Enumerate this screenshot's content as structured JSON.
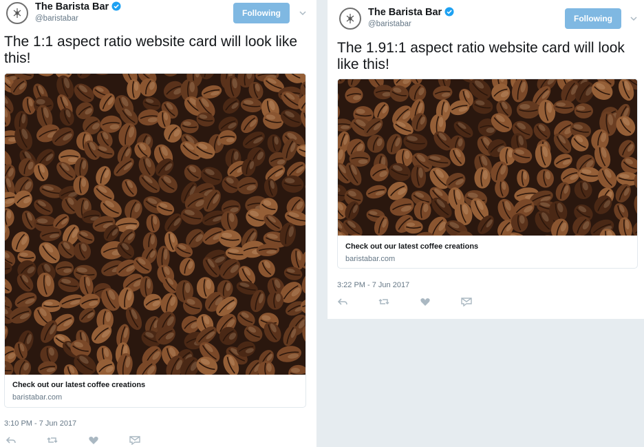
{
  "colors": {
    "accent": "#1da1f2",
    "following_bg": "#7fb8e2",
    "muted": "#657786",
    "bean_dark": "#3a2418"
  },
  "left": {
    "name": "The Barista Bar",
    "handle": "@baristabar",
    "follow_label": "Following",
    "text": "The 1:1 aspect ratio website card will look like this!",
    "card_title": "Check out our latest coffee creations",
    "card_domain": "baristabar.com",
    "timestamp": "3:10 PM - 7 Jun 2017",
    "icons": [
      "verified-badge-icon",
      "chevron-down-icon",
      "reply-icon",
      "retweet-icon",
      "like-icon",
      "direct-message-icon"
    ]
  },
  "right": {
    "name": "The Barista Bar",
    "handle": "@baristabar",
    "follow_label": "Following",
    "text": "The 1.91:1 aspect ratio website card will look like this!",
    "card_title": "Check out our latest coffee creations",
    "card_domain": "baristabar.com",
    "timestamp": "3:22 PM - 7 Jun 2017",
    "icons": [
      "verified-badge-icon",
      "chevron-down-icon",
      "reply-icon",
      "retweet-icon",
      "like-icon",
      "direct-message-icon"
    ]
  }
}
